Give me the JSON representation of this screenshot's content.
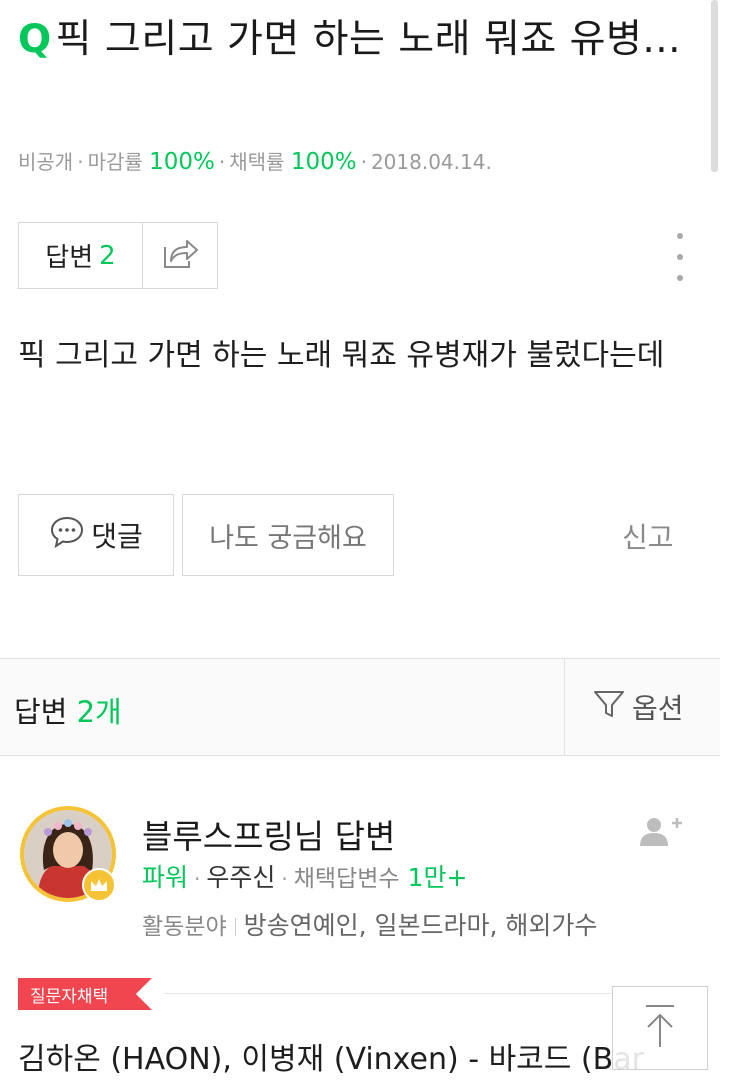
{
  "question": {
    "q_mark": "Q",
    "title": "픽 그리고 가면 하는 노래 뭐죠 유병...",
    "meta": {
      "visibility": "비공개",
      "deadline_rate_label": "마감률",
      "deadline_rate": "100%",
      "accept_rate_label": "채택률",
      "accept_rate": "100%",
      "date": "2018.04.14."
    },
    "answer_button_label": "답변",
    "answer_button_count": "2",
    "body": "픽 그리고 가면 하는 노래 뭐죠 유병재가 불렀다는데",
    "comment_label": "댓글",
    "curious_label": "나도 궁금해요",
    "report_label": "신고"
  },
  "answers_header": {
    "label": "답변",
    "count": "2개",
    "options_label": "옵션"
  },
  "answer": {
    "answerer_name": "블루스프링님 답변",
    "power_label": "파워",
    "level": "우주신",
    "accepted_count_label": "채택답변수",
    "accepted_count": "1만+",
    "field_label": "활동분야",
    "fields": "방송연예인, 일본드라마, 해외가수",
    "accepted_badge": "질문자채택",
    "text": "김하온 (HAON), 이병재 (Vinxen) - 바코드 (Bar"
  },
  "colors": {
    "accent_green": "#03c75a",
    "badge_red": "#f1454f",
    "avatar_ring": "#f5c335"
  },
  "icons": [
    "share-icon",
    "more-vert-icon",
    "speech-bubble-icon",
    "filter-icon",
    "add-friend-icon",
    "crown-icon",
    "arrow-up-icon"
  ]
}
